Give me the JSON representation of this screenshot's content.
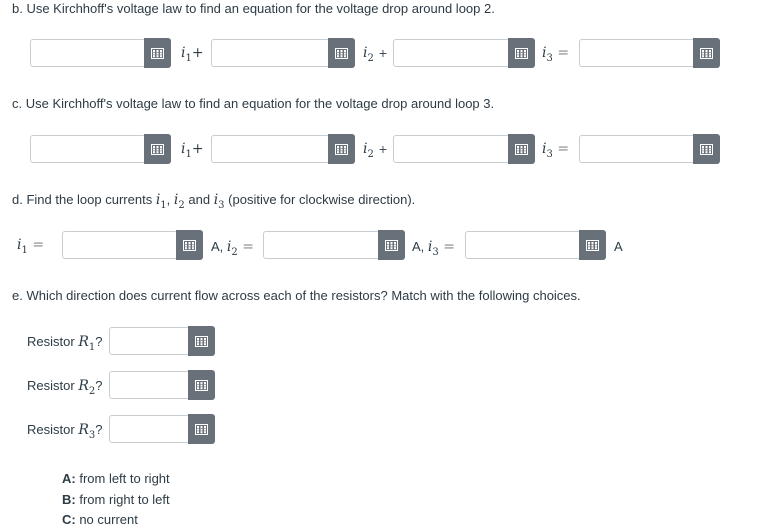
{
  "part_b": {
    "question": "b. Use Kirchhoff's voltage law to find an equation for the voltage drop around loop 2.",
    "term1": "i",
    "sub1": "1",
    "op1": "+",
    "term2": "i",
    "sub2": "2",
    "op2": "+",
    "term3": "i",
    "sub3": "3",
    "op3": "="
  },
  "part_c": {
    "question": "c. Use Kirchhoff's voltage law to find an equation for the voltage drop around loop 3.",
    "term1": "i",
    "sub1": "1",
    "op1": "+",
    "term2": "i",
    "sub2": "2",
    "op2": "+",
    "term3": "i",
    "sub3": "3",
    "op3": "="
  },
  "part_d": {
    "question_prefix": "d. Find the loop currents ",
    "v1": "i",
    "s1": "1",
    "comma1": ", ",
    "v2": "i",
    "s2": "2",
    "and_text": " and ",
    "v3": "i",
    "s3": "3",
    "question_suffix": " (positive for clockwise direction).",
    "lhs_var": "i",
    "lhs_sub": "1",
    "eq": "=",
    "unit1": "A,",
    "unit2": "A,",
    "unit3": "A"
  },
  "part_e": {
    "question": "e. Which direction does current flow across each of the resistors? Match with the following choices.",
    "resistor_word": "Resistor",
    "r_var": "R",
    "r1_sub": "1",
    "r2_sub": "2",
    "r3_sub": "3",
    "qmark": "?",
    "choices": [
      {
        "key": "A:",
        "text": " from left to right"
      },
      {
        "key": "B:",
        "text": " from right to left"
      },
      {
        "key": "C:",
        "text": " no current"
      }
    ]
  },
  "icons": {
    "keypad": "keypad-icon"
  },
  "colors": {
    "keypad_button": "#68717a",
    "field_border": "#c7cdd1",
    "text": "#2d3b45"
  }
}
